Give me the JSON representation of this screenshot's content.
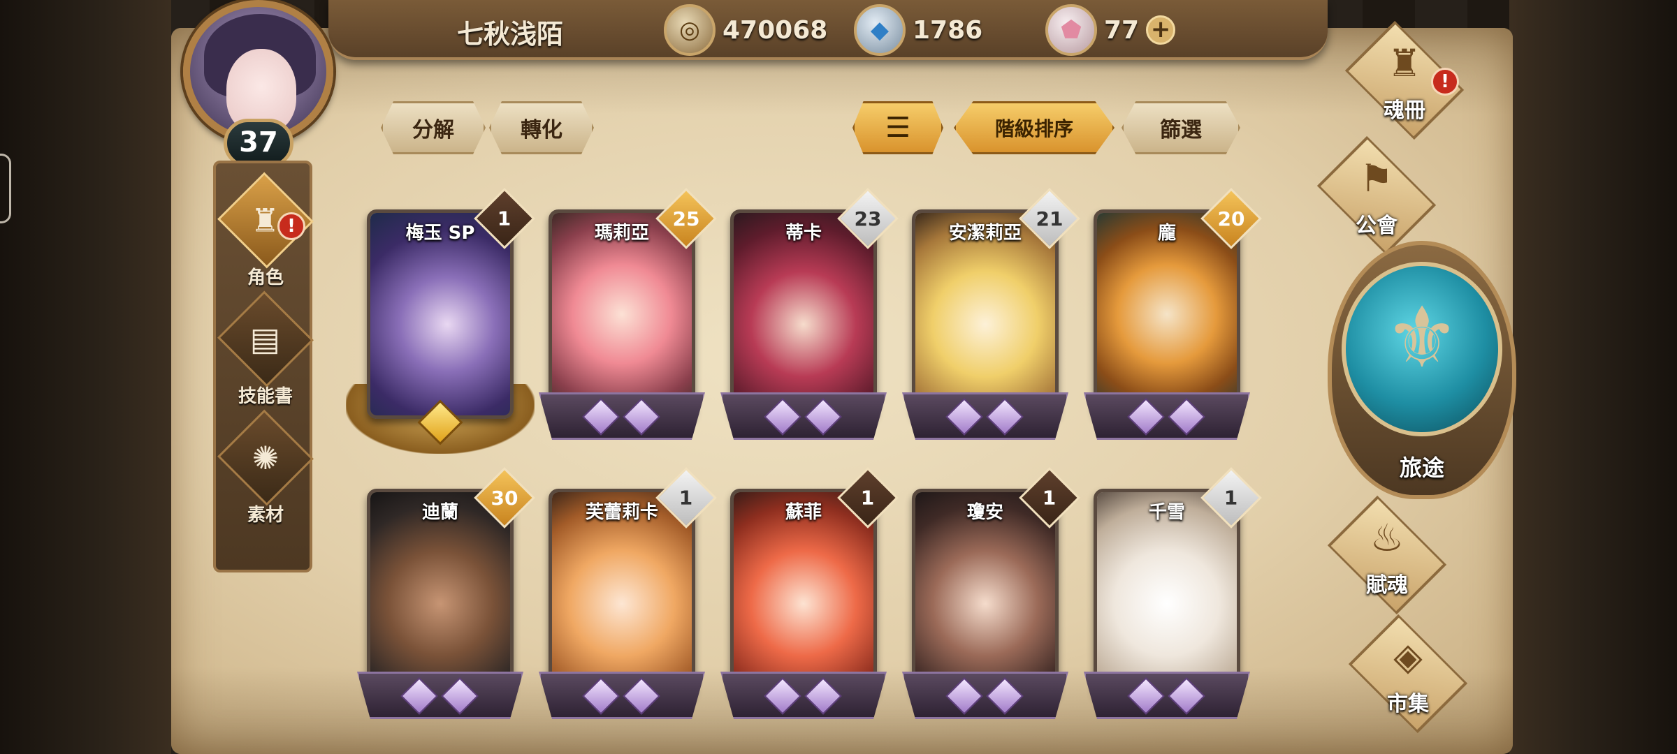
{
  "player": {
    "name": "七秋浅陌",
    "level": "37"
  },
  "resources": [
    {
      "icon": "gold-coin-icon",
      "value": "470068"
    },
    {
      "icon": "blue-crystal-icon",
      "value": "1786"
    },
    {
      "icon": "pink-gem-icon",
      "value": "77"
    }
  ],
  "left_nav": [
    {
      "label": "角色",
      "icon": "character-icon",
      "active": true,
      "alert": true
    },
    {
      "label": "技能書",
      "icon": "skill-book-icon",
      "active": false,
      "alert": false
    },
    {
      "label": "素材",
      "icon": "material-icon",
      "active": false,
      "alert": false
    }
  ],
  "toolbar": {
    "decompose": "分解",
    "convert": "轉化",
    "sort_icon": "sort-icon",
    "sort_by_rank": "階級排序",
    "filter": "篩選"
  },
  "characters": [
    {
      "name": "梅玉 SP",
      "rank": "1",
      "badge": "dark"
    },
    {
      "name": "瑪莉亞",
      "rank": "25",
      "badge": "gold"
    },
    {
      "name": "蒂卡",
      "rank": "23",
      "badge": "silver"
    },
    {
      "name": "安潔莉亞",
      "rank": "21",
      "badge": "silver"
    },
    {
      "name": "龐",
      "rank": "20",
      "badge": "gold"
    },
    {
      "name": "迪蘭",
      "rank": "30",
      "badge": "gold"
    },
    {
      "name": "芙蕾莉卡",
      "rank": "1",
      "badge": "silver"
    },
    {
      "name": "蘇菲",
      "rank": "1",
      "badge": "dark"
    },
    {
      "name": "瓊安",
      "rank": "1",
      "badge": "dark"
    },
    {
      "name": "千雪",
      "rank": "1",
      "badge": "silver"
    }
  ],
  "right_nav": {
    "soul_book": "魂冊",
    "guild": "公會",
    "journey": "旅途",
    "endow_soul": "賦魂",
    "market": "市集"
  },
  "alert_mark": "!",
  "plus_mark": "+"
}
